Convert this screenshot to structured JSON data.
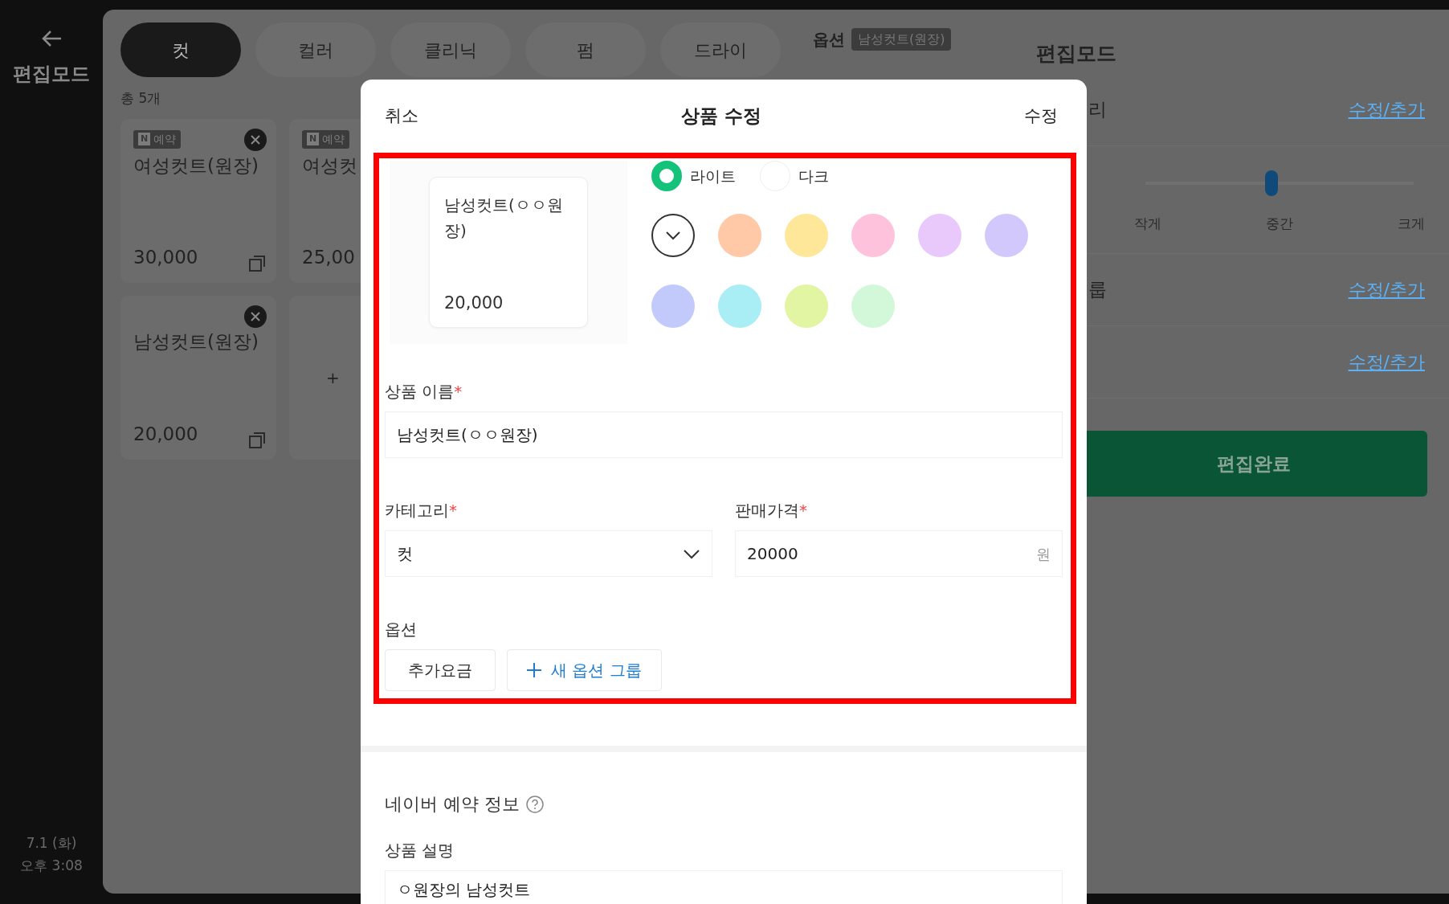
{
  "sidebar": {
    "title": "편집모드",
    "date": "7.1 (화)",
    "time": "오후 3:08"
  },
  "category_tabs": [
    {
      "label": "컷",
      "selected": true
    },
    {
      "label": "컬러",
      "selected": false
    },
    {
      "label": "클리닉",
      "selected": false
    },
    {
      "label": "펌",
      "selected": false
    },
    {
      "label": "드라이",
      "selected": false
    }
  ],
  "item_count": "총 5개",
  "product_cards": [
    {
      "kind": "product",
      "logo": "N",
      "badge": "예약",
      "name": "여성컷트(원장)",
      "price": "30,000",
      "delete": true,
      "copy": true
    },
    {
      "kind": "product",
      "logo": "N",
      "badge": "예약",
      "name": "여성컷",
      "price": "25,00"
    },
    {
      "kind": "product",
      "name": "남성컷트(원장)",
      "price": "20,000",
      "delete": true,
      "copy": true
    },
    {
      "kind": "add",
      "label": "+"
    }
  ],
  "options_panel": {
    "title": "옵션",
    "tag": "남성컷트(원장)"
  },
  "settings_panel": {
    "title": "편집모드",
    "rows": [
      {
        "kind": "link",
        "label": "리",
        "action": "수정/추가"
      },
      {
        "kind": "slider",
        "level": 0.47,
        "ticks": [
          "작게",
          "중간",
          "크게"
        ]
      },
      {
        "kind": "link",
        "label": "룹",
        "action": "수정/추가"
      },
      {
        "kind": "link",
        "action": "수정/추가"
      }
    ],
    "done_button": "편집완료"
  },
  "modal": {
    "cancel": "취소",
    "title": "상품 수정",
    "confirm": "수정",
    "product_form": {
      "highlighted": true,
      "preview": {
        "name": "남성컷트(ㅇㅇ원장)",
        "price": "20,000"
      },
      "themes": [
        {
          "label": "라이트",
          "selected": true
        },
        {
          "label": "다크",
          "selected": false
        }
      ],
      "colors": [
        {
          "color": "#ffffff",
          "selected": true
        },
        {
          "color": "#ffc8a6",
          "selected": false
        },
        {
          "color": "#ffe79a",
          "selected": false
        },
        {
          "color": "#ffc2dc",
          "selected": false
        },
        {
          "color": "#e9c8fc",
          "selected": false
        },
        {
          "color": "#d2c8fb",
          "selected": false
        },
        {
          "color": "#c2cafb",
          "selected": false
        },
        {
          "color": "#a9eef5",
          "selected": false
        },
        {
          "color": "#e2f5a3",
          "selected": false
        },
        {
          "color": "#d3f8d9",
          "selected": false
        }
      ],
      "name": {
        "label": "상품 이름",
        "mark": "*",
        "value": "남성컷트(ㅇㅇ원장)"
      },
      "category": {
        "label": "카테고리",
        "mark": "*",
        "value": "컷"
      },
      "price": {
        "label": "판매가격",
        "mark": "*",
        "value": "20000",
        "unit": "원"
      },
      "options": {
        "label": "옵션",
        "groups": [
          "추가요금"
        ],
        "add": "새 옵션 그룹"
      }
    },
    "naver": {
      "title": "네이버 예약 정보",
      "description_label": "상품 설명",
      "description": "ㅇ원장의 남성컷트"
    }
  }
}
